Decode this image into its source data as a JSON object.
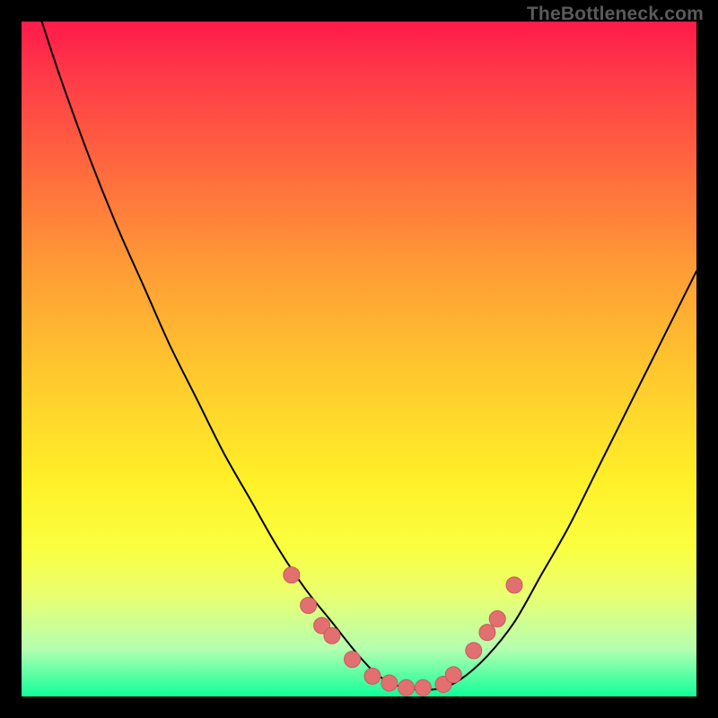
{
  "watermark": "TheBottleneck.com",
  "chart_data": {
    "type": "line",
    "title": "",
    "xlabel": "",
    "ylabel": "",
    "xlim": [
      0,
      100
    ],
    "ylim": [
      0,
      100
    ],
    "series": [
      {
        "name": "curve",
        "x": [
          3,
          6,
          10,
          14,
          18,
          22,
          26,
          30,
          34,
          38,
          42,
          46,
          50,
          53,
          56,
          59,
          62,
          65,
          69,
          73,
          77,
          81,
          85,
          89,
          93,
          97,
          100
        ],
        "y": [
          100,
          91,
          80,
          70,
          61,
          52,
          44,
          36,
          29,
          22,
          16,
          11,
          6,
          3,
          1.5,
          1,
          1.2,
          2.5,
          6,
          11,
          18,
          25,
          33,
          41,
          49,
          57,
          63
        ]
      }
    ],
    "markers": {
      "name": "dots",
      "x": [
        40,
        42.5,
        44.5,
        46,
        49,
        52,
        54.5,
        57,
        59.5,
        62.5,
        64,
        67,
        69,
        70.5,
        73
      ],
      "y": [
        18,
        13.5,
        10.5,
        9,
        5.5,
        3,
        2,
        1.3,
        1.3,
        1.8,
        3.2,
        6.8,
        9.5,
        11.5,
        16.5
      ]
    },
    "colors": {
      "curve": "#000000",
      "marker_fill": "#e27070",
      "marker_stroke": "#c95a5a"
    }
  }
}
